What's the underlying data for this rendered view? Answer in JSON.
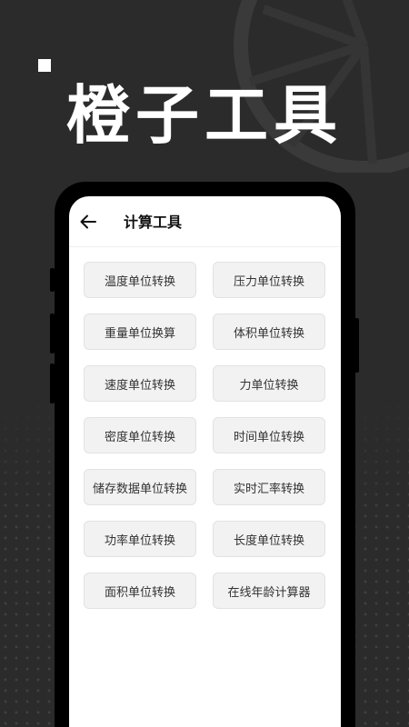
{
  "hero": {
    "title": "橙子工具"
  },
  "app": {
    "header": {
      "title": "计算工具"
    },
    "tools": [
      "温度单位转换",
      "压力单位转换",
      "重量单位换算",
      "体积单位转换",
      "速度单位转换",
      "力单位转换",
      "密度单位转换",
      "时间单位转换",
      "储存数据单位转换",
      "实时汇率转换",
      "功率单位转换",
      "长度单位转换",
      "面积单位转换",
      "在线年龄计算器"
    ]
  },
  "colors": {
    "background": "#2b2b2b",
    "frame": "#000000",
    "screen": "#ffffff",
    "button_bg": "#f2f2f2",
    "text": "#333333"
  },
  "icons": {
    "back": "arrow-left-icon",
    "decor": "orange-slice-icon"
  }
}
